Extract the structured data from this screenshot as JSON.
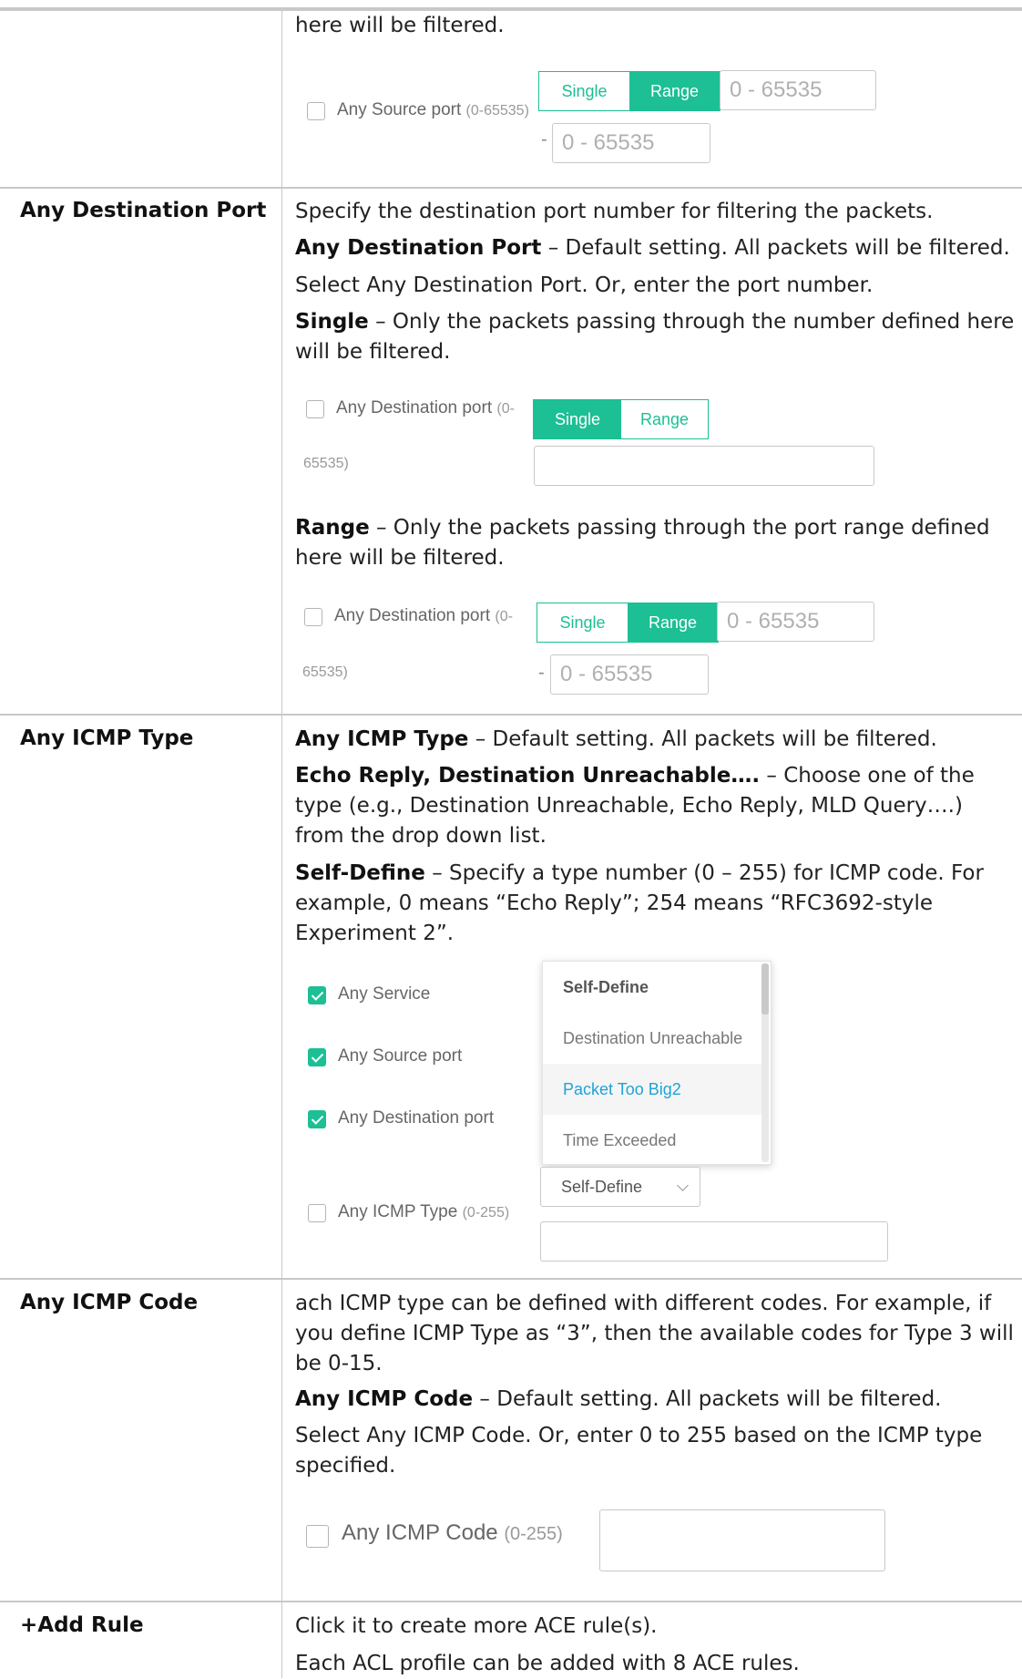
{
  "source_port_row": {
    "cont_text": "here will be filtered.",
    "ui": {
      "checkbox_label": "Any Source port",
      "range_hint": "(0-65535)",
      "single": "Single",
      "range": "Range",
      "from_placeholder": "0 - 65535",
      "dash": "-",
      "to_placeholder": "0 - 65535"
    }
  },
  "dest_port_row": {
    "heading": "Any Destination Port",
    "p1": "Specify the destination port number for filtering the packets.",
    "p2_bold": "Any Destination Port",
    "p2_rest": " – Default setting. All packets will be filtered.",
    "p3": "Select Any Destination Port. Or, enter the port number.",
    "p4_bold": "Single",
    "p4_rest": " – Only the packets passing through the number defined here will be filtered.",
    "ui_single": {
      "checkbox_label": "Any Destination port",
      "range_hint_a": "(0-",
      "range_hint_b": "65535)",
      "single": "Single",
      "range": "Range"
    },
    "p5_bold": "Range",
    "p5_rest": " – Only the packets passing through the port range defined here will be filtered.",
    "ui_range": {
      "checkbox_label": "Any Destination port",
      "range_hint_a": "(0-",
      "range_hint_b": "65535)",
      "single": "Single",
      "range": "Range",
      "from_placeholder": "0 - 65535",
      "dash": "-",
      "to_placeholder": "0 - 65535"
    }
  },
  "icmp_type_row": {
    "heading": "Any ICMP Type",
    "p1_bold": "Any ICMP Type",
    "p1_rest": " – Default setting. All packets will be filtered.",
    "p2_bold": "Echo Reply, Destination Unreachable….",
    "p2_rest": " – Choose one of the type (e.g., Destination Unreachable, Echo Reply, MLD Query….) from the drop down list.",
    "p3_bold": "Self-Define",
    "p3_rest": " – Specify a type number (0 – 255) for ICMP code. For example, 0 means “Echo Reply”; 254 means “RFC3692-style Experiment 2”.",
    "ui": {
      "any_service": "Any Service",
      "any_source_port": "Any Source port",
      "any_destination_port": "Any Destination port",
      "any_icmp_type": "Any ICMP Type",
      "range_hint": "(0-255)",
      "dropdown_items": [
        "Self-Define",
        "Destination Unreachable",
        "Packet Too Big2",
        "Time Exceeded"
      ],
      "select_value": "Self-Define"
    }
  },
  "icmp_code_row": {
    "heading": "Any ICMP Code",
    "p1": "ach ICMP type can be defined with different codes. For example, if you define ICMP Type as “3”, then the available codes for Type 3 will be 0-15.",
    "p2_bold": "Any ICMP Code",
    "p2_rest": " – Default setting. All packets will be filtered.",
    "p3": "Select Any ICMP Code. Or, enter 0 to 255 based on the ICMP type specified.",
    "ui": {
      "checkbox_label": "Any ICMP Code",
      "range_hint": "(0-255)"
    }
  },
  "add_rule_row": {
    "heading": "+Add Rule",
    "p1": "Click it to create more ACE rule(s).",
    "p2": "Each ACL profile can be added with 8 ACE rules."
  },
  "colors": {
    "accent": "#1dbf94",
    "selected_item": "#1fa3d7",
    "border": "#c8c8c8"
  }
}
